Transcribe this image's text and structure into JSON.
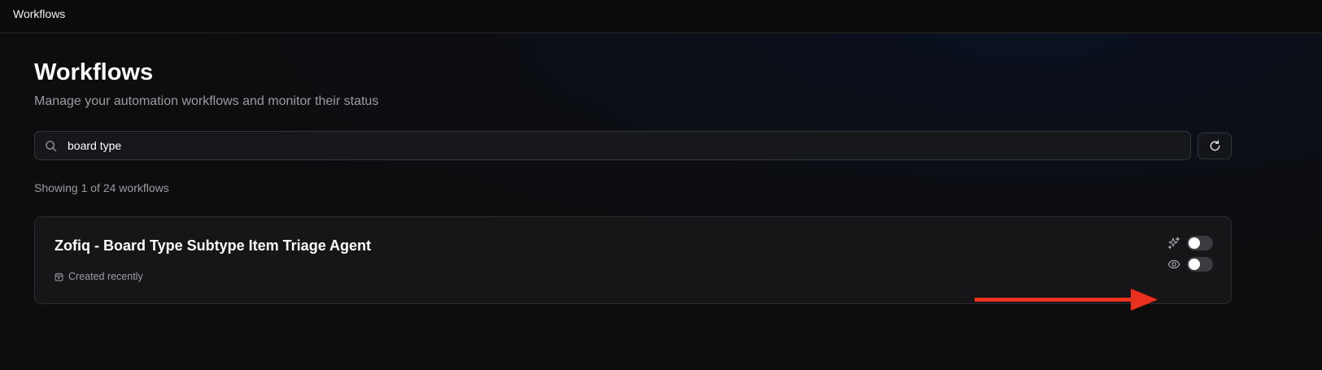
{
  "topbar": {
    "title": "Workflows"
  },
  "page": {
    "title": "Workflows",
    "subtitle": "Manage your automation workflows and monitor their status"
  },
  "search": {
    "value": "board type",
    "icon": "search-icon"
  },
  "toolbar": {
    "refresh_icon": "refresh-icon"
  },
  "results": {
    "summary": "Showing 1 of 24 workflows"
  },
  "workflows": [
    {
      "title": "Zofiq - Board Type Subtype Item Triage Agent",
      "created": "Created recently",
      "ai_toggle": {
        "icon": "sparkles-icon",
        "on": false
      },
      "visibility_toggle": {
        "icon": "eye-icon",
        "on": false
      }
    }
  ],
  "colors": {
    "background": "#0d0d0e",
    "card": "#161618",
    "border": "#2b2c31",
    "muted_text": "#9b9ca3",
    "annotation_arrow": "#e8321f"
  }
}
